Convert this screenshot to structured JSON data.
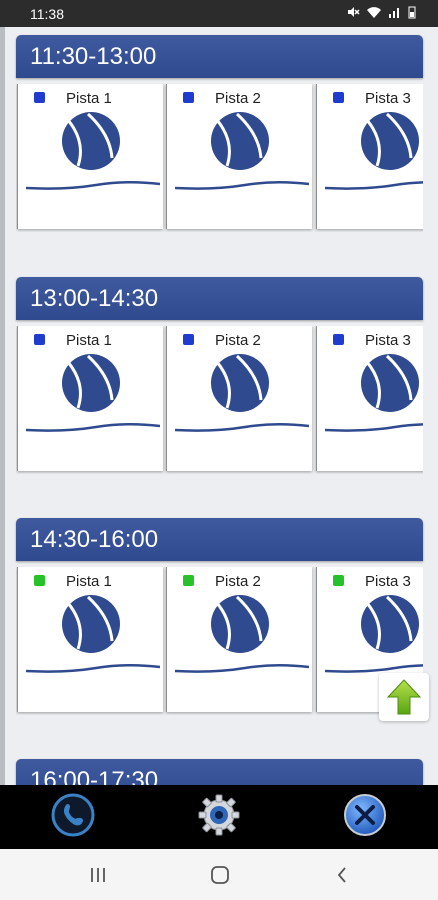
{
  "status": {
    "time": "11:38"
  },
  "slots": [
    {
      "time": "11:30-13:00",
      "courts": [
        {
          "label": "Pista 1",
          "status_color": "#1f3ccf"
        },
        {
          "label": "Pista 2",
          "status_color": "#1f3ccf"
        },
        {
          "label": "Pista 3",
          "status_color": "#1f3ccf"
        }
      ]
    },
    {
      "time": "13:00-14:30",
      "courts": [
        {
          "label": "Pista 1",
          "status_color": "#1f3ccf"
        },
        {
          "label": "Pista 2",
          "status_color": "#1f3ccf"
        },
        {
          "label": "Pista 3",
          "status_color": "#1f3ccf"
        }
      ]
    },
    {
      "time": "14:30-16:00",
      "courts": [
        {
          "label": "Pista 1",
          "status_color": "#27c12a"
        },
        {
          "label": "Pista 2",
          "status_color": "#27c12a"
        },
        {
          "label": "Pista 3",
          "status_color": "#27c12a"
        }
      ]
    },
    {
      "time": "16:00-17:30",
      "courts": []
    }
  ],
  "toolbar": {
    "icons": [
      "phone-icon",
      "settings-icon",
      "close-icon"
    ]
  },
  "navbar": {
    "icons": [
      "recents-icon",
      "home-icon",
      "back-icon"
    ]
  },
  "colors": {
    "header": "#2f4a8e",
    "ball": "#2f4a8e",
    "available": "#27c12a",
    "reserved": "#1f3ccf"
  }
}
